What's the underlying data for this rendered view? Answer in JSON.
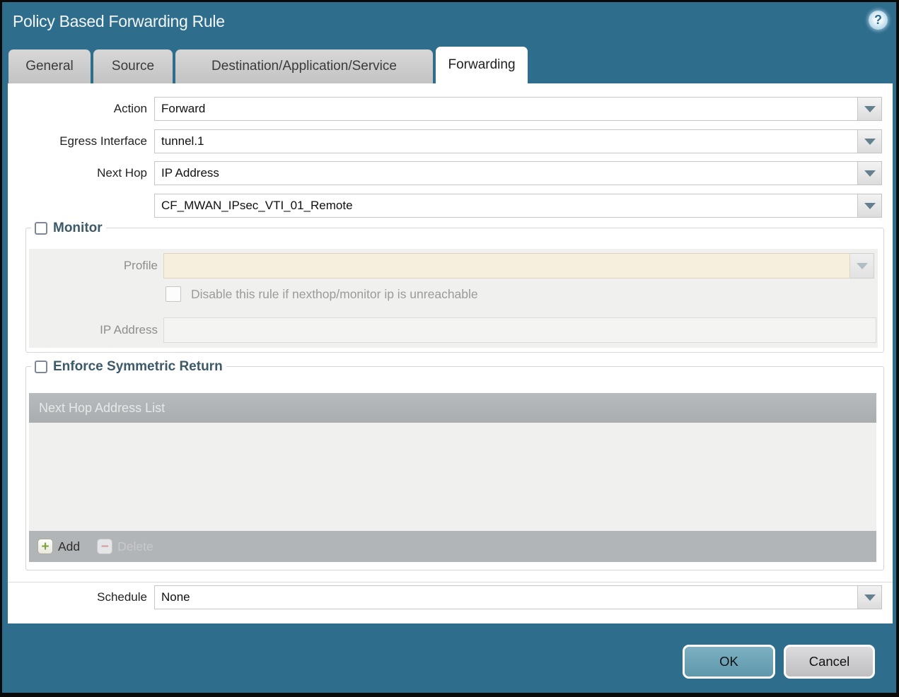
{
  "window": {
    "title": "Policy Based Forwarding Rule"
  },
  "icons": {
    "help": "?",
    "add": "+",
    "delete": "−"
  },
  "tabs": [
    {
      "label": "General",
      "active": false
    },
    {
      "label": "Source",
      "active": false
    },
    {
      "label": "Destination/Application/Service",
      "active": false
    },
    {
      "label": "Forwarding",
      "active": true
    }
  ],
  "form": {
    "action_label": "Action",
    "action_value": "Forward",
    "egress_label": "Egress Interface",
    "egress_value": "tunnel.1",
    "next_hop_label": "Next Hop",
    "next_hop_value": "IP Address",
    "next_hop_address_value": "CF_MWAN_IPsec_VTI_01_Remote",
    "schedule_label": "Schedule",
    "schedule_value": "None"
  },
  "monitor": {
    "label": "Monitor",
    "checked": false,
    "profile_label": "Profile",
    "profile_value": "",
    "disable_rule_label": "Disable this rule if nexthop/monitor ip is unreachable",
    "disable_rule_checked": false,
    "ip_address_label": "IP Address",
    "ip_address_value": ""
  },
  "symmetric_return": {
    "label": "Enforce Symmetric Return",
    "checked": false,
    "table_header": "Next Hop Address List",
    "rows": [],
    "add_label": "Add",
    "delete_label": "Delete"
  },
  "footer": {
    "ok_label": "OK",
    "cancel_label": "Cancel"
  },
  "colors": {
    "frame_teal": "#2f6d8d",
    "active_tab": "#ffffff",
    "inactive_tab": "#c9c9c9",
    "legend_text": "#3d5a69",
    "profile_field": "#f6efde",
    "table_header": "#aeb1b4",
    "ok_button": "#6da3b7",
    "cancel_button": "#c9c9cc"
  }
}
